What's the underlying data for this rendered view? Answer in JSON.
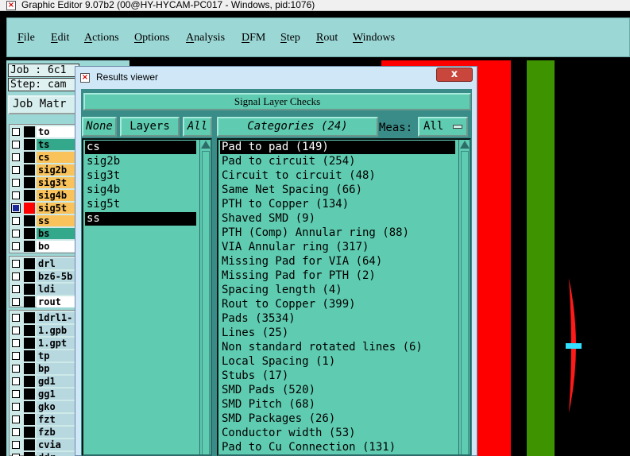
{
  "window": {
    "title": "Graphic Editor 9.07b2 (00@HY-HYCAM-PC017 - Windows, pid:1076)"
  },
  "menubar": {
    "items": [
      "File",
      "Edit",
      "Actions",
      "Options",
      "Analysis",
      "DFM",
      "Step",
      "Rout",
      "Windows"
    ]
  },
  "left_panel": {
    "job_line": "Job : 6c1",
    "step_line": "Step: cam",
    "job_matrix_label": "Job Matr",
    "layers_group1": [
      {
        "name": "to",
        "color": "#ffffff",
        "active": false
      },
      {
        "name": "ts",
        "color": "#33a88a",
        "active": false
      },
      {
        "name": "cs",
        "color": "#f9c25a",
        "active": false
      },
      {
        "name": "sig2b",
        "color": "#f9c25a",
        "active": false
      },
      {
        "name": "sig3t",
        "color": "#f9c25a",
        "active": false
      },
      {
        "name": "sig4b",
        "color": "#f9c25a",
        "active": false
      },
      {
        "name": "sig5t",
        "color": "#f9c25a",
        "active": true
      },
      {
        "name": "ss",
        "color": "#f9c25a",
        "active": false
      },
      {
        "name": "bs",
        "color": "#33a88a",
        "active": false
      },
      {
        "name": "bo",
        "color": "#ffffff",
        "active": false
      }
    ],
    "layers_group2": [
      {
        "name": "drl",
        "color": "#b8d8e0",
        "active": false
      },
      {
        "name": "bz6-5b",
        "color": "#b8d8e0",
        "active": false
      },
      {
        "name": "ldi",
        "color": "#b8d8e0",
        "active": false
      },
      {
        "name": "rout",
        "color": "#ffffff",
        "active": false
      }
    ],
    "layers_group3": [
      {
        "name": "1drl1-",
        "color": "#b8d8e0"
      },
      {
        "name": "1.gpb",
        "color": "#b8d8e0"
      },
      {
        "name": "1.gpt",
        "color": "#b8d8e0"
      },
      {
        "name": "tp",
        "color": "#b8d8e0"
      },
      {
        "name": "bp",
        "color": "#b8d8e0"
      },
      {
        "name": "gd1",
        "color": "#b8d8e0"
      },
      {
        "name": "gg1",
        "color": "#b8d8e0"
      },
      {
        "name": "gko",
        "color": "#b8d8e0"
      },
      {
        "name": "fzt",
        "color": "#b8d8e0"
      },
      {
        "name": "fzb",
        "color": "#b8d8e0"
      },
      {
        "name": "cvia",
        "color": "#b8d8e0"
      },
      {
        "name": "ddr",
        "color": "#b8d8e0"
      }
    ]
  },
  "results_viewer": {
    "title": "Results viewer",
    "close_label": "x",
    "header": "Signal Layer Checks",
    "none_label": "None",
    "layers_label": "Layers",
    "all_label": "All",
    "categories_label": "Categories (24)",
    "meas_label": "Meas:",
    "meas_value": "All",
    "layers": [
      "cs",
      "sig2b",
      "sig3t",
      "sig4b",
      "sig5t",
      "ss"
    ],
    "selected_layers": [
      0,
      5
    ],
    "categories": [
      "Pad to pad (149)",
      "Pad to circuit (254)",
      "Circuit to circuit (48)",
      "Same Net Spacing (66)",
      "PTH to Copper (134)",
      "Shaved SMD (9)",
      "PTH (Comp) Annular ring (88)",
      "VIA Annular ring (317)",
      "Missing Pad for VIA (64)",
      "Missing Pad for PTH (2)",
      "Spacing length (4)",
      "Rout to Copper (399)",
      "Pads (3534)",
      "Lines (25)",
      "Non standard rotated lines (6)",
      "Local Spacing (1)",
      "Stubs (17)",
      "SMD Pads (520)",
      "SMD Pitch (68)",
      "SMD Packages (26)",
      "Conductor width (53)",
      "Pad to Cu Connection (131)"
    ],
    "selected_category": 0
  },
  "colors": {
    "canvas_bg": "#000000",
    "panel_teal": "#9bd7d5",
    "dialog_green": "#5fcbb0",
    "stripe_red": "#ff0000",
    "stripe_green": "#3d9400"
  }
}
